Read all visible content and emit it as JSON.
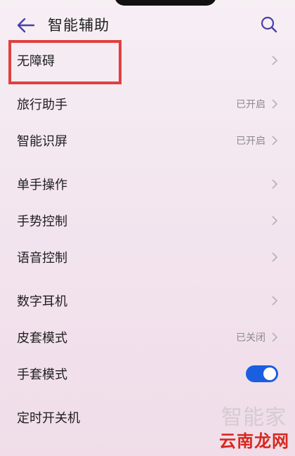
{
  "header": {
    "title": "智能辅助"
  },
  "items": [
    {
      "label": "无障碍",
      "status": ""
    },
    {
      "label": "旅行助手",
      "status": "已开启"
    },
    {
      "label": "智能识屏",
      "status": "已开启"
    },
    {
      "label": "单手操作",
      "status": ""
    },
    {
      "label": "手势控制",
      "status": ""
    },
    {
      "label": "语音控制",
      "status": ""
    },
    {
      "label": "数字耳机",
      "status": ""
    },
    {
      "label": "皮套模式",
      "status": "已关闭"
    },
    {
      "label": "手套模式",
      "status": "",
      "toggle_on": true
    },
    {
      "label": "定时开关机",
      "status": ""
    }
  ],
  "watermark": {
    "top_text": "智能家",
    "text": "云南龙网"
  },
  "colors": {
    "toggle_on": "#1a5fe0",
    "highlight_box": "#e0403e",
    "accent": "#4a3fa8"
  },
  "icons": [
    "back-arrow-icon",
    "search-icon",
    "chevron-right-icon"
  ]
}
